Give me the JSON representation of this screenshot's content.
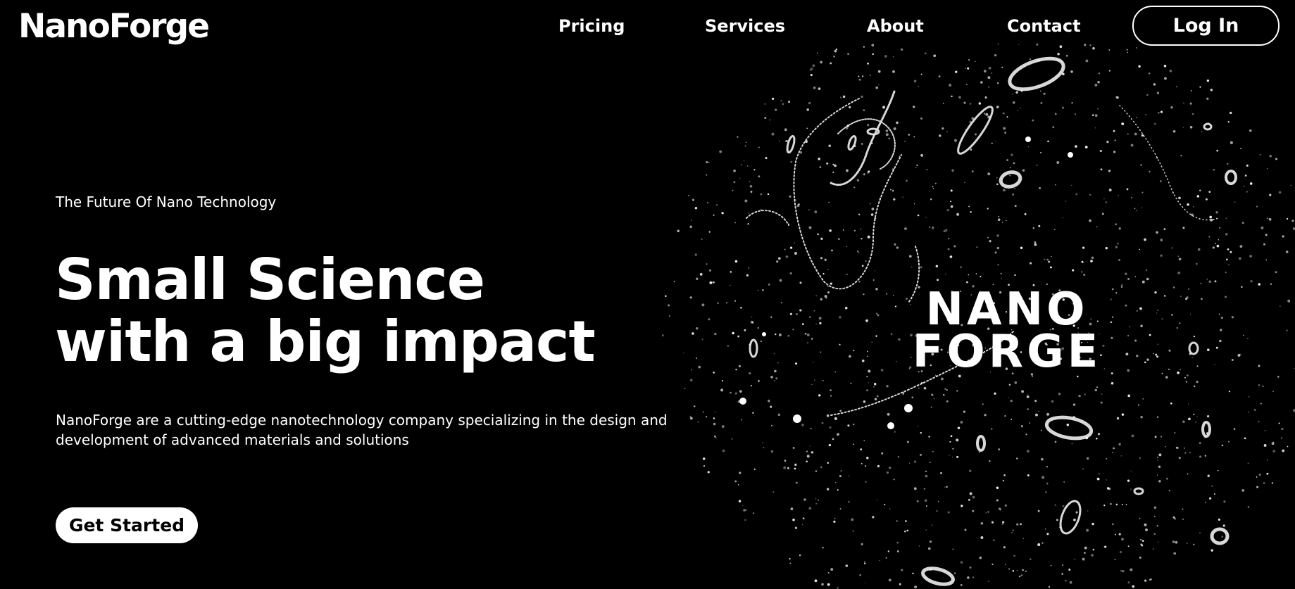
{
  "header": {
    "logo": "NanoForge",
    "nav": [
      {
        "label": "Pricing"
      },
      {
        "label": "Services"
      },
      {
        "label": "About"
      },
      {
        "label": "Contact"
      }
    ],
    "login_label": "Log In"
  },
  "hero": {
    "eyebrow": "The Future Of Nano Technology",
    "headline_line1": "Small Science",
    "headline_line2": "with a big impact",
    "description": "NanoForge are a cutting-edge nanotechnology company specializing in the design and development of advanced materials and solutions",
    "cta_label": "Get Started"
  },
  "visual": {
    "wordmark_line1": "NANO",
    "wordmark_line2": "FORGE",
    "background_color": "#000000",
    "particle_color": "#ffffff"
  }
}
